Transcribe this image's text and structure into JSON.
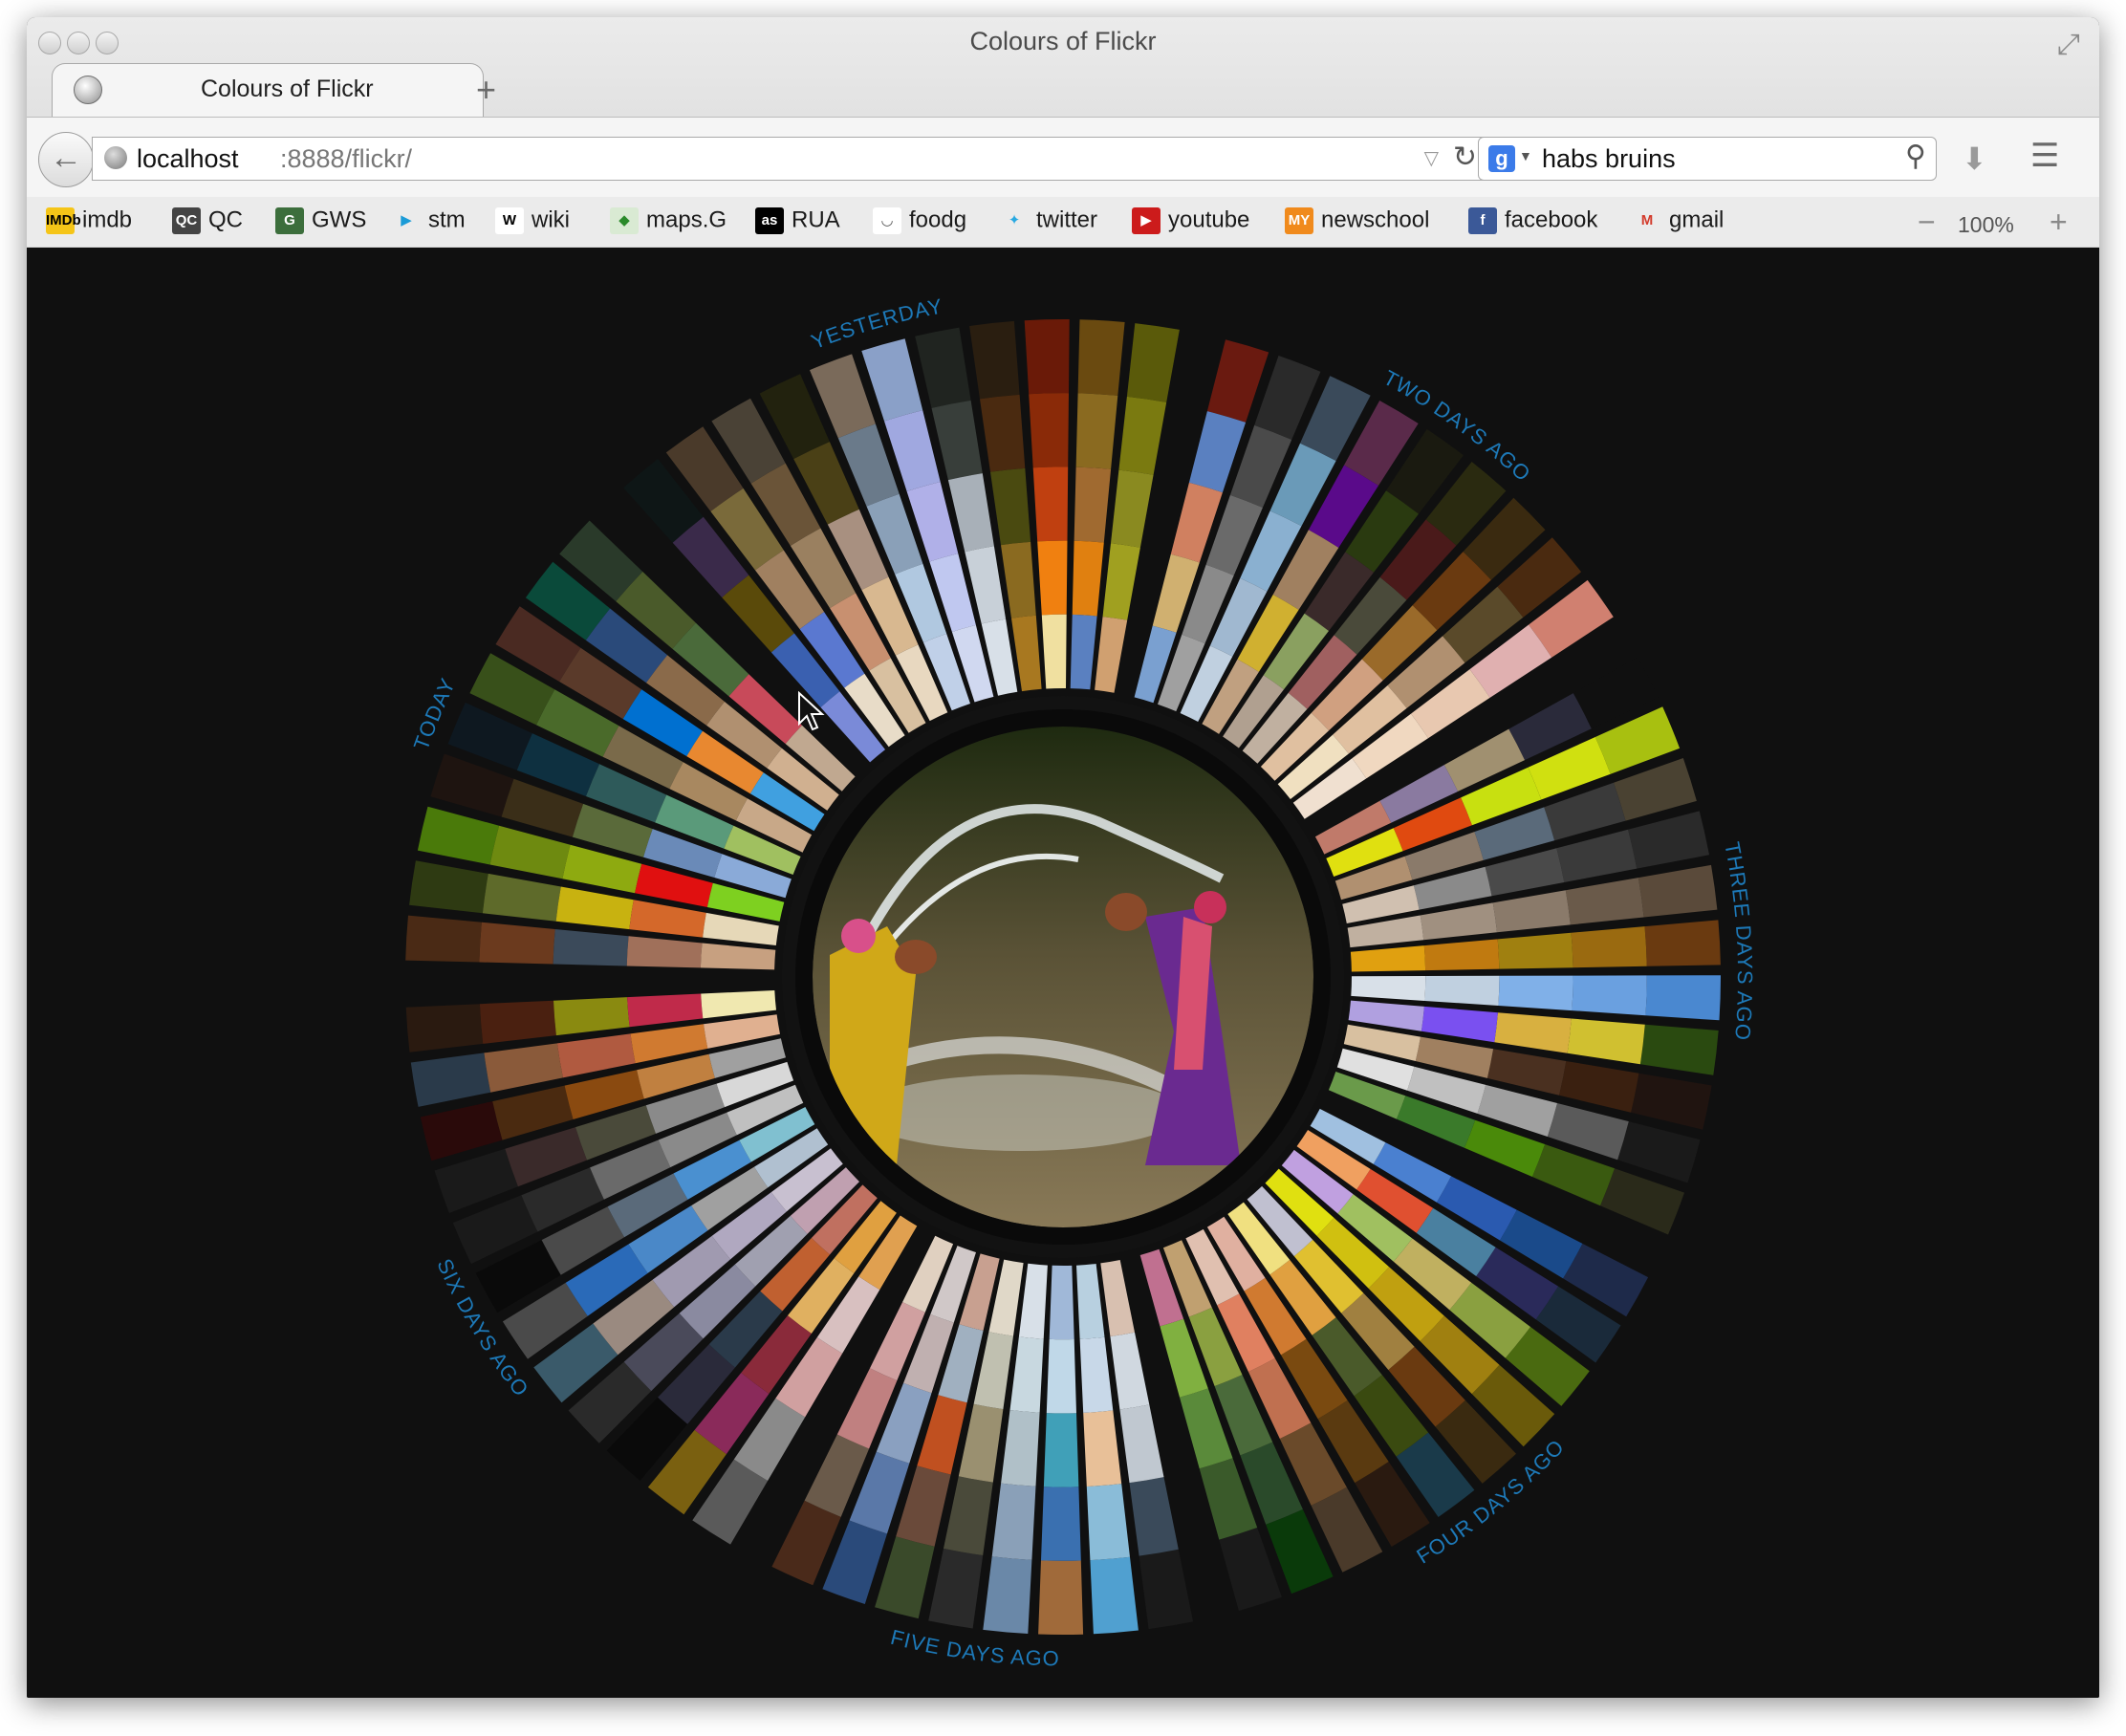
{
  "window": {
    "title": "Colours of Flickr"
  },
  "tab": {
    "title": "Colours of Flickr",
    "new_tab_label": "+"
  },
  "navbar": {
    "url_host": "localhost",
    "url_path": ":8888/flickr/",
    "search_engine": "g",
    "search_query": "habs bruins"
  },
  "bookmarks": [
    {
      "label": "imdb",
      "icon": "imdb-icon",
      "icon_text": "IMDb",
      "color": "#f5c518",
      "fg": "#000000"
    },
    {
      "label": "QC",
      "icon": "qc-icon",
      "icon_text": "QC",
      "color": "#444444",
      "fg": "#ffffff"
    },
    {
      "label": "GWS",
      "icon": "gws-icon",
      "icon_text": "G",
      "color": "#3c6e3c",
      "fg": "#ffffff"
    },
    {
      "label": "stm",
      "icon": "stm-icon",
      "icon_text": "▶",
      "color": "#ebebeb",
      "fg": "#1a9bd7"
    },
    {
      "label": "wiki",
      "icon": "wikipedia-icon",
      "icon_text": "W",
      "color": "#ffffff",
      "fg": "#000000"
    },
    {
      "label": "maps.G",
      "icon": "maps-icon",
      "icon_text": "◆",
      "color": "#d9ead3",
      "fg": "#2a8a2a"
    },
    {
      "label": "RUA",
      "icon": "rua-icon",
      "icon_text": "as",
      "color": "#000000",
      "fg": "#ffffff"
    },
    {
      "label": "foodg",
      "icon": "foodg-icon",
      "icon_text": "◡",
      "color": "#ffffff",
      "fg": "#555555"
    },
    {
      "label": "twitter",
      "icon": "twitter-icon",
      "icon_text": "✦",
      "color": "#ebebeb",
      "fg": "#29a9e1"
    },
    {
      "label": "youtube",
      "icon": "youtube-icon",
      "icon_text": "▶",
      "color": "#cc1b1b",
      "fg": "#ffffff"
    },
    {
      "label": "newschool",
      "icon": "newschool-icon",
      "icon_text": "MY",
      "color": "#f08a1c",
      "fg": "#ffffff"
    },
    {
      "label": "facebook",
      "icon": "facebook-icon",
      "icon_text": "f",
      "color": "#3b5998",
      "fg": "#ffffff"
    },
    {
      "label": "gmail",
      "icon": "gmail-icon",
      "icon_text": "M",
      "color": "#ebebeb",
      "fg": "#d33b2c"
    }
  ],
  "zoom": {
    "minus": "−",
    "level": "100%",
    "plus": "+"
  },
  "wheel": {
    "center_photo": "women-splashing-water-photo",
    "days": [
      {
        "label": "TODAY",
        "swatches": [
          [
            "#4a2a15",
            "#6b3a1e",
            "#3b4a5a",
            "#a0705a",
            "#c7a080"
          ],
          [
            "#2e3a12",
            "#5e6a2a",
            "#c8b210",
            "#d4682a",
            "#e6d8b8"
          ],
          [
            "#4a7a0a",
            "#6e8a10",
            "#8eaa10",
            "#e01010",
            "#7ed020"
          ],
          [
            "#1e1410",
            "#3a2e18",
            "#5a6a3a",
            "#6a8ab8",
            "#8aaad8"
          ],
          [
            "#0e1820",
            "#0e3040",
            "#2e5a5a",
            "#5a9a7a",
            "#a0c060"
          ],
          [
            "#38501a",
            "#4a6a2a",
            "#7a6a4a",
            "#a88860",
            "#c8a888"
          ],
          [
            "#4a2a22",
            "#5a3a2a",
            "#0070d0",
            "#e88830",
            "#40a0e0"
          ],
          [
            "#0a4a3a",
            "#2a4a7a",
            "#8a6a4a",
            "#b09070",
            "#d0b090"
          ],
          [
            "#2a3a2a",
            "#4a5a2a",
            "#4a6a3a",
            "#c84a5a",
            "#c0a890"
          ]
        ]
      },
      {
        "label": "YESTERDAY",
        "swatches": [
          [
            "#0e1616",
            "#3a2a4a",
            "#5a4a0a",
            "#3a60b0",
            "#7a8ad8"
          ],
          [
            "#4a3a2a",
            "#7a6a3a",
            "#a08060",
            "#5a78d0",
            "#e8dcc8"
          ],
          [
            "#4a4236",
            "#6a5438",
            "#9a8060",
            "#c89070",
            "#d8c0a0"
          ],
          [
            "#22220e",
            "#4a4016",
            "#a89080",
            "#d8b890",
            "#e8d8c0"
          ],
          [
            "#7a6a5a",
            "#6a7a8a",
            "#8aa0b8",
            "#b0c8e0",
            "#c0d0e8"
          ],
          [
            "#8aa0c8",
            "#a0a8e0",
            "#b0b0e8",
            "#c0c8f0",
            "#d0d8f0"
          ],
          [
            "#202420",
            "#383e3a",
            "#a8b0b8",
            "#c8d0d8",
            "#d8e0e8"
          ],
          [
            "#2a1e10",
            "#4a2a10",
            "#4a4a10",
            "#8a6a20",
            "#a87820"
          ],
          [
            "#6a1a08",
            "#8a2a08",
            "#c04010",
            "#f08010",
            "#f0e0a0"
          ],
          [
            "#6a4a10",
            "#8a6a20",
            "#a06a30",
            "#e08010",
            "#5a80c0"
          ],
          [
            "#5a5a0a",
            "#7a7a10",
            "#8a8a20",
            "#a0a020",
            "#d0a070"
          ]
        ]
      },
      {
        "label": "TWO DAYS AGO",
        "swatches": [
          [
            "#6a1a10",
            "#5a80c0",
            "#d08060",
            "#d0b070",
            "#7aa0d0"
          ],
          [
            "#2a2a2a",
            "#4a4a4a",
            "#6a6a6a",
            "#8a8a8a",
            "#a0a0a0"
          ],
          [
            "#3a4a5a",
            "#6a9ab8",
            "#8ab0d0",
            "#a0b8d0",
            "#c0d0e0"
          ],
          [
            "#5a2a4a",
            "#5a0a8a",
            "#a08060",
            "#d0b030",
            "#c0a080"
          ],
          [
            "#1a1a10",
            "#2a3a10",
            "#3a2a2a",
            "#8aa060",
            "#b0a090"
          ],
          [
            "#2a2a10",
            "#4a1a1a",
            "#4a4a3a",
            "#a06060",
            "#c0b0a0"
          ],
          [
            "#3a2a10",
            "#6a3a10",
            "#9a6a2a",
            "#d0a080",
            "#e0c0a0"
          ],
          [
            "#4a2a10",
            "#5a4a2a",
            "#b09070",
            "#e0c0a0",
            "#f0e0c0"
          ],
          [
            "#d08070",
            "#e0b0b0",
            "#e8c8b0",
            "#f0d8c0",
            "#f0e0d0"
          ]
        ]
      },
      {
        "label": "THREE DAYS AGO",
        "swatches": [
          [
            "#101010",
            "#2a2a3a",
            "#a09070",
            "#8a7aa0",
            "#c07a6a"
          ],
          [
            "#a8c010",
            "#d0e010",
            "#c8e010",
            "#e04a10",
            "#e0e010"
          ],
          [
            "#4a4232",
            "#3a3a3a",
            "#5a6a7a",
            "#8a7a6a",
            "#b09070"
          ],
          [
            "#2a2a2a",
            "#3a3a3a",
            "#4a4a4a",
            "#8a8a8a",
            "#d0c0b0"
          ],
          [
            "#5a4a3a",
            "#6a5a4a",
            "#8a7a6a",
            "#a09080",
            "#c0b0a0"
          ],
          [
            "#6a3a10",
            "#9a6a10",
            "#a08010",
            "#c07a10",
            "#e0a010"
          ],
          [
            "#4a88d0",
            "#6aa0e0",
            "#80b0e8",
            "#c0d0e0",
            "#d8e0e8"
          ],
          [
            "#2a4a10",
            "#d0c030",
            "#d8b040",
            "#7a50f0",
            "#b0a0e0"
          ],
          [
            "#201410",
            "#3a2010",
            "#4a3020",
            "#a08060",
            "#d8c0a0"
          ],
          [
            "#1a1a1a",
            "#5a5a5a",
            "#a0a0a0",
            "#c0c0c0",
            "#e0e0e0"
          ],
          [
            "#2a2a1a",
            "#3a5a10",
            "#4a8a0a",
            "#3a7a2a",
            "#6a9a4a"
          ]
        ]
      },
      {
        "label": "FOUR DAYS AGO",
        "swatches": [
          [
            "#1e2a4a",
            "#1a4a8a",
            "#2a5ab0",
            "#4a80d0",
            "#a0c0e0"
          ],
          [
            "#1a2a3a",
            "#2a2a5a",
            "#4a80a0",
            "#e05030",
            "#f0a060"
          ],
          [
            "#4a6a10",
            "#8aa040",
            "#c0b060",
            "#a0c060",
            "#c0a0e0"
          ],
          [
            "#6a5a0a",
            "#a08010",
            "#c0a010",
            "#d0c010",
            "#e0e010"
          ],
          [
            "#3a2a10",
            "#6a3a10",
            "#a08040",
            "#e0c030",
            "#c0c0d0"
          ],
          [
            "#1a3a4a",
            "#3a4a10",
            "#4a5a2a",
            "#e0a040",
            "#f0e080"
          ],
          [
            "#2a1a10",
            "#5a3a10",
            "#7a4a10",
            "#d07a30",
            "#e0b0a0"
          ],
          [
            "#4a3a2a",
            "#6a4a2a",
            "#c07050",
            "#e08060",
            "#e0c0b0"
          ],
          [
            "#0a3a0a",
            "#2a4a2a",
            "#4a6a3a",
            "#8aa040",
            "#c0a070"
          ],
          [
            "#1a1a1a",
            "#3a5a2a",
            "#5a8a3a",
            "#80b040",
            "#c07090"
          ]
        ]
      },
      {
        "label": "FIVE DAYS AGO",
        "swatches": [
          [
            "#1a1a1a",
            "#3a4a5a",
            "#c0c8d0",
            "#d0d8e0",
            "#d8c0b0"
          ],
          [
            "#50a0d0",
            "#8abcd8",
            "#e8c098",
            "#c8d8e8",
            "#b8d0e0"
          ],
          [
            "#a06a3a",
            "#3a70b0",
            "#40a0b8",
            "#c0d8e8",
            "#a0b8d8"
          ],
          [
            "#6a88a8",
            "#8aa0b8",
            "#b0c0c8",
            "#c8d8e0",
            "#d8e0e8"
          ],
          [
            "#2a2a2a",
            "#4a4a3a",
            "#9a9070",
            "#c0c0b0",
            "#e0d8c8"
          ],
          [
            "#3a4a2a",
            "#6a4a3a",
            "#c05020",
            "#a0b0c0",
            "#c8a090"
          ],
          [
            "#2a4a7a",
            "#5a78a8",
            "#8aa0c0",
            "#c0b0b0",
            "#d0c8c8"
          ],
          [
            "#4a2a1a",
            "#6a5a4a",
            "#c08080",
            "#d0a0a0",
            "#e0d0c0"
          ]
        ]
      },
      {
        "label": "SIX DAYS AGO",
        "swatches": [
          [
            "#5a5a5a",
            "#8a8a8a",
            "#d0a0a0",
            "#d8c0c0",
            "#e0a050"
          ],
          [
            "#7a6010",
            "#8a2a5a",
            "#8a2a3a",
            "#e0b060",
            "#e0a040"
          ],
          [
            "#0a0a0a",
            "#2a2a3a",
            "#2a3a4a",
            "#c06030",
            "#c07060"
          ],
          [
            "#2a2a2a",
            "#4a4a5a",
            "#8a8aa0",
            "#a0a0b0",
            "#c0a0b0"
          ],
          [
            "#3a5a6a",
            "#9a8a80",
            "#a09ab0",
            "#b0a8c0",
            "#c8c0d0"
          ],
          [
            "#4a4a4a",
            "#2a6ab8",
            "#4a88c8",
            "#a0a0a0",
            "#b0c0d0"
          ],
          [
            "#0a0a0a",
            "#4a4a4a",
            "#5a6a7a",
            "#4a90d0",
            "#80c0d0"
          ],
          [
            "#1a1a1a",
            "#2a2a2a",
            "#6a6a6a",
            "#8a8a8a",
            "#c0c0c0"
          ],
          [
            "#1a1a1a",
            "#3a2a2a",
            "#4a4a3a",
            "#8a8a8a",
            "#d8d8d8"
          ],
          [
            "#2a0a0a",
            "#4a2a10",
            "#8a4a10",
            "#c08040",
            "#a0a0a0"
          ],
          [
            "#2a3a4a",
            "#8a5a3a",
            "#b05a40",
            "#d07a30",
            "#e0b090"
          ],
          [
            "#2a1a10",
            "#4a2010",
            "#8a8a10",
            "#c02a4a",
            "#f0e8b0"
          ]
        ]
      }
    ]
  }
}
